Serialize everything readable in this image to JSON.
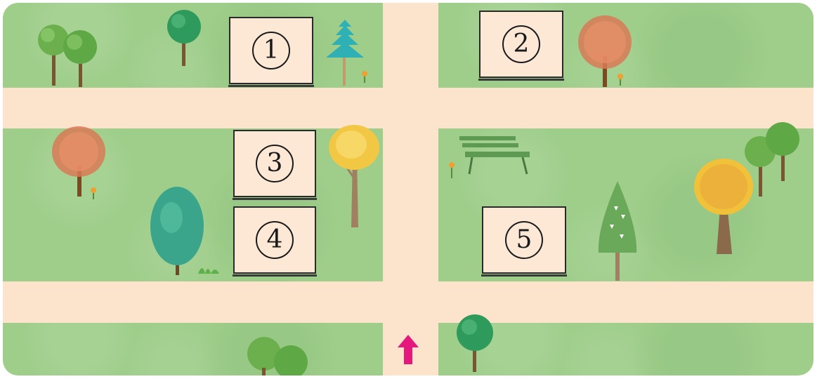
{
  "buildings": [
    {
      "id": "1",
      "label": "1"
    },
    {
      "id": "2",
      "label": "2"
    },
    {
      "id": "3",
      "label": "3"
    },
    {
      "id": "4",
      "label": "4"
    },
    {
      "id": "5",
      "label": "5"
    }
  ],
  "colors": {
    "grass": "#9fce8b",
    "road": "#fbe3cc",
    "building": "#fde8d6",
    "arrow": "#e5197d"
  },
  "icons": [
    "tree-icon",
    "bench-icon",
    "arrow-up-icon",
    "flower-icon"
  ]
}
